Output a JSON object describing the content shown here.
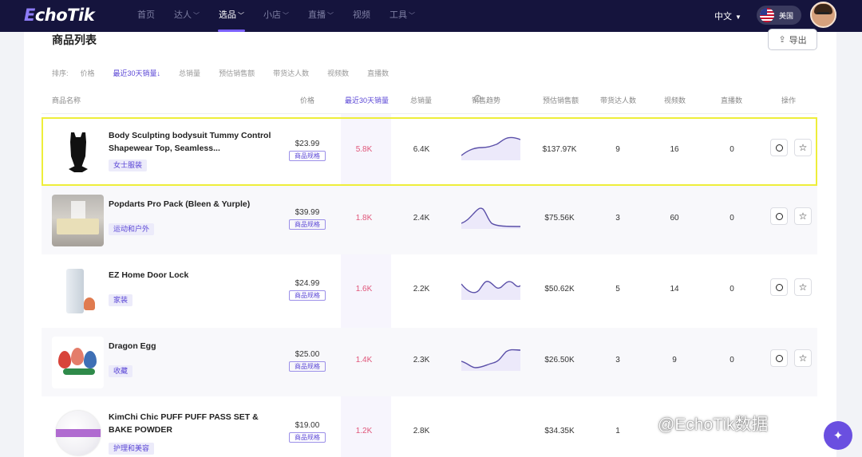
{
  "logo": {
    "prefix": "E",
    "rest": "choTik"
  },
  "nav": [
    {
      "label": "首页",
      "caret": false,
      "active": false
    },
    {
      "label": "达人",
      "caret": true,
      "active": false
    },
    {
      "label": "选品",
      "caret": true,
      "active": true
    },
    {
      "label": "小店",
      "caret": true,
      "active": false
    },
    {
      "label": "直播",
      "caret": true,
      "active": false
    },
    {
      "label": "视频",
      "caret": false,
      "active": false
    },
    {
      "label": "工具",
      "caret": true,
      "active": false
    }
  ],
  "language": "中文",
  "region": "美国",
  "page_title": "商品列表",
  "export_label": "导出",
  "sort": {
    "label": "排序:",
    "options": [
      {
        "label": "价格",
        "active": false
      },
      {
        "label": "最近30天销量↓",
        "active": true
      },
      {
        "label": "总销量",
        "active": false
      },
      {
        "label": "预估销售额",
        "active": false
      },
      {
        "label": "带货达人数",
        "active": false
      },
      {
        "label": "视频数",
        "active": false
      },
      {
        "label": "直播数",
        "active": false
      }
    ]
  },
  "columns": {
    "name": "商品名称",
    "price": "价格",
    "sales30": "最近30天销量",
    "total_sales": "总销量",
    "trend": "销售趋势",
    "revenue": "预估销售额",
    "creators": "带货达人数",
    "videos": "视频数",
    "lives": "直播数",
    "actions": "操作"
  },
  "spec_label": "商品规格",
  "accent_color": "#7b61ff",
  "highlight_color": "#eeee3a",
  "products": [
    {
      "name": "Body Sculpting bodysuit Tummy Control Shapewear Top, Seamless...",
      "category": "女士服装",
      "price": "$23.99",
      "sales30": "5.8K",
      "total_sales": "6.4K",
      "revenue": "$137.97K",
      "creators": "9",
      "videos": "16",
      "lives": "0",
      "selected": true
    },
    {
      "name": "Popdarts Pro Pack (Bleen & Yurple)",
      "category": "运动和户外",
      "price": "$39.99",
      "sales30": "1.8K",
      "total_sales": "2.4K",
      "revenue": "$75.56K",
      "creators": "3",
      "videos": "60",
      "lives": "0",
      "selected": false
    },
    {
      "name": "EZ Home Door Lock",
      "category": "家装",
      "price": "$24.99",
      "sales30": "1.6K",
      "total_sales": "2.2K",
      "revenue": "$50.62K",
      "creators": "5",
      "videos": "14",
      "lives": "0",
      "selected": false
    },
    {
      "name": "Dragon Egg",
      "category": "收藏",
      "price": "$25.00",
      "sales30": "1.4K",
      "total_sales": "2.3K",
      "revenue": "$26.50K",
      "creators": "3",
      "videos": "9",
      "lives": "0",
      "selected": false
    },
    {
      "name": "KimChi Chic PUFF PUFF PASS SET & BAKE POWDER",
      "category": "护理和美容",
      "price": "$19.00",
      "sales30": "1.2K",
      "total_sales": "2.8K",
      "revenue": "$34.35K",
      "creators": "1",
      "videos": "",
      "lives": "",
      "selected": false
    }
  ],
  "watermark": "@EchoTik数据"
}
